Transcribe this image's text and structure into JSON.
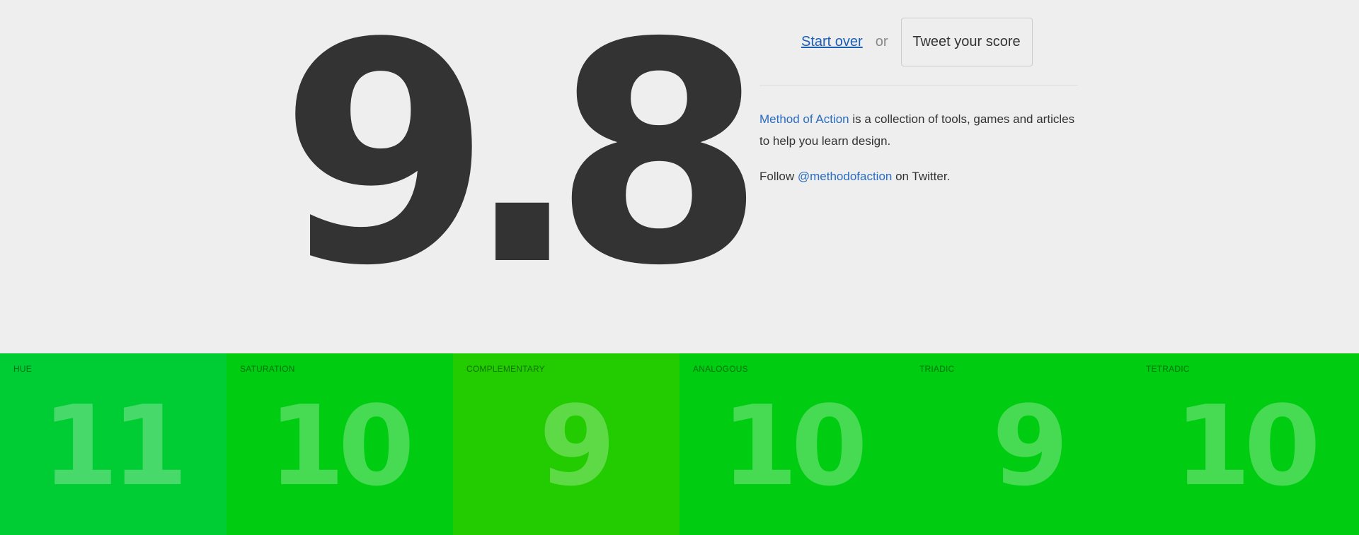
{
  "score": {
    "value": "9.8"
  },
  "actions": {
    "start_over": "Start over",
    "or": "or",
    "tweet": "Tweet your score"
  },
  "about": {
    "link_text": "Method of Action",
    "text": " is a collection of tools, games and articles to help you learn design."
  },
  "follow": {
    "prefix": "Follow ",
    "handle": "@methodofaction",
    "suffix": " on Twitter."
  },
  "tiles": [
    {
      "label": "HUE",
      "score": "11",
      "color": "#00cc33"
    },
    {
      "label": "SATURATION",
      "score": "10",
      "color": "#00cc11"
    },
    {
      "label": "COMPLEMENTARY",
      "score": "9",
      "color": "#22cc00"
    },
    {
      "label": "ANALOGOUS",
      "score": "10",
      "color": "#00cc11"
    },
    {
      "label": "TRIADIC",
      "score": "9",
      "color": "#00cc11"
    },
    {
      "label": "TETRADIC",
      "score": "10",
      "color": "#00cc11"
    }
  ],
  "colors": {
    "background": "#eeeeee",
    "text": "#333333",
    "link": "#2a6cc0"
  }
}
